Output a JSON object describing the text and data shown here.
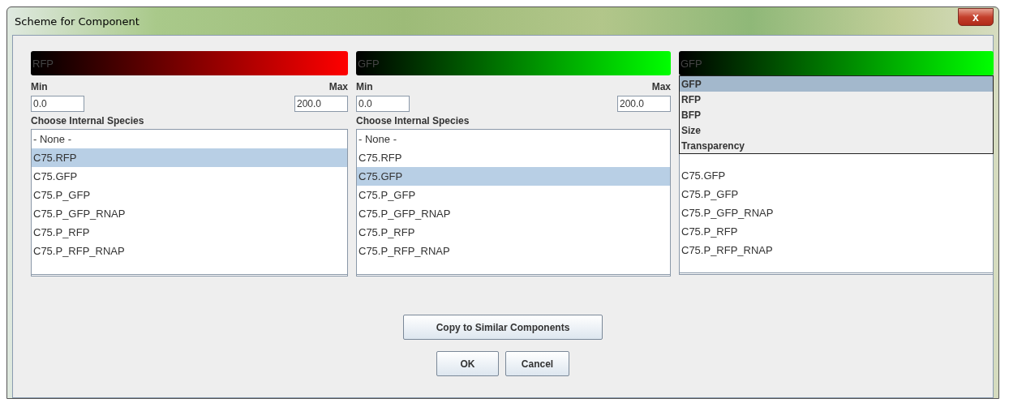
{
  "window": {
    "title": "Scheme for Component",
    "close": "x"
  },
  "panels": [
    {
      "bar": {
        "label": "RFP",
        "color": "#ff0000"
      },
      "min_label": "Min",
      "max_label": "Max",
      "min": "0.0",
      "max": "200.0",
      "species_label": "Choose Internal Species",
      "items": [
        {
          "label": "- None -",
          "selected": false
        },
        {
          "label": "C75.RFP",
          "selected": true
        },
        {
          "label": "C75.GFP",
          "selected": false
        },
        {
          "label": "C75.P_GFP",
          "selected": false
        },
        {
          "label": "C75.P_GFP_RNAP",
          "selected": false
        },
        {
          "label": "C75.P_RFP",
          "selected": false
        },
        {
          "label": "C75.P_RFP_RNAP",
          "selected": false
        }
      ]
    },
    {
      "bar": {
        "label": "GFP",
        "color": "#00ff00"
      },
      "min_label": "Min",
      "max_label": "Max",
      "min": "0.0",
      "max": "200.0",
      "species_label": "Choose Internal Species",
      "items": [
        {
          "label": "- None -",
          "selected": false
        },
        {
          "label": "C75.RFP",
          "selected": false
        },
        {
          "label": "C75.GFP",
          "selected": true
        },
        {
          "label": "C75.P_GFP",
          "selected": false
        },
        {
          "label": "C75.P_GFP_RNAP",
          "selected": false
        },
        {
          "label": "C75.P_RFP",
          "selected": false
        },
        {
          "label": "C75.P_RFP_RNAP",
          "selected": false
        }
      ]
    },
    {
      "bar": {
        "label": "GFP",
        "color": "#00ff00"
      },
      "dropdown": [
        {
          "label": "GFP",
          "selected": true
        },
        {
          "label": "RFP",
          "selected": false
        },
        {
          "label": "BFP",
          "selected": false
        },
        {
          "label": "Size",
          "selected": false
        },
        {
          "label": "Transparency",
          "selected": false
        }
      ],
      "items": [
        {
          "label": "C75.GFP",
          "selected": false
        },
        {
          "label": "C75.P_GFP",
          "selected": false
        },
        {
          "label": "C75.P_GFP_RNAP",
          "selected": false
        },
        {
          "label": "C75.P_RFP",
          "selected": false
        },
        {
          "label": "C75.P_RFP_RNAP",
          "selected": false
        }
      ]
    }
  ],
  "buttons": {
    "copy": "Copy to Similar Components",
    "ok": "OK",
    "cancel": "Cancel"
  }
}
